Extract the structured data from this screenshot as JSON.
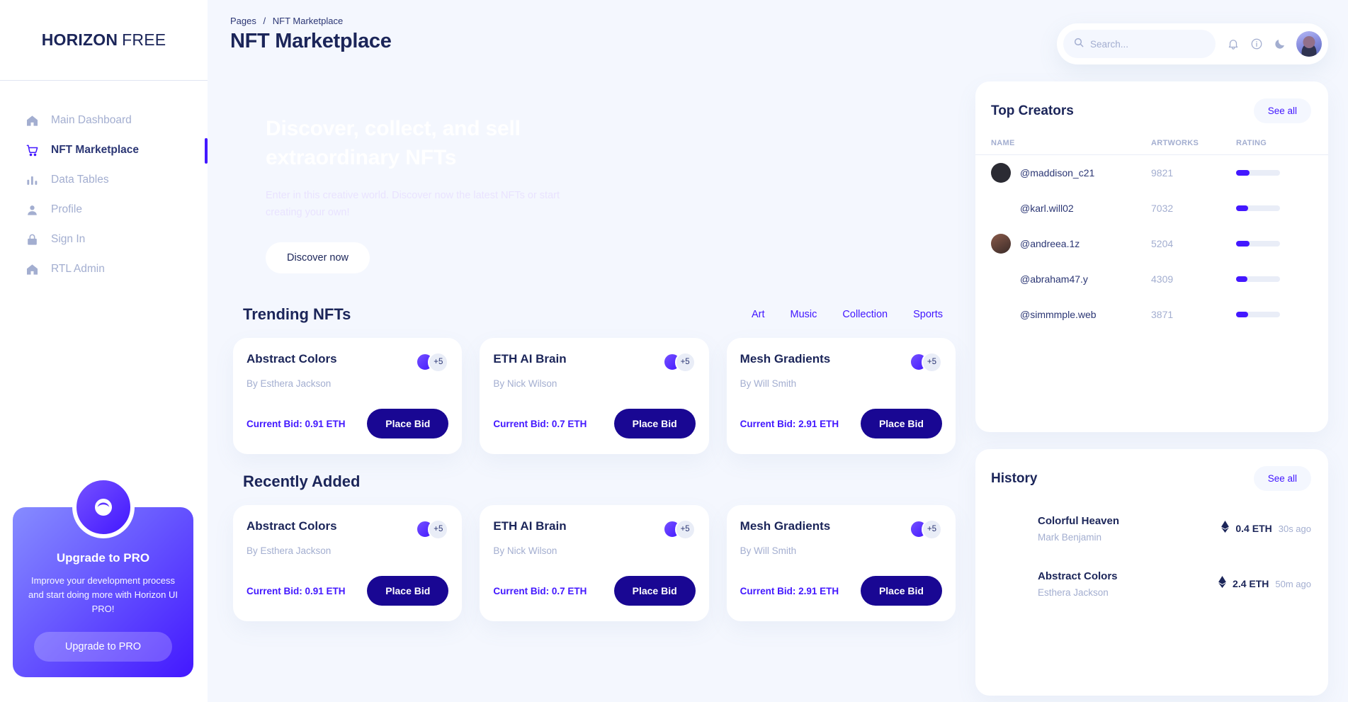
{
  "sidebar": {
    "brand_bold": "HORIZON",
    "brand_light": "FREE",
    "items": [
      {
        "label": "Main Dashboard",
        "icon": "home-icon",
        "active": false
      },
      {
        "label": "NFT Marketplace",
        "icon": "cart-icon",
        "active": true
      },
      {
        "label": "Data Tables",
        "icon": "bar-chart-icon",
        "active": false
      },
      {
        "label": "Profile",
        "icon": "person-icon",
        "active": false
      },
      {
        "label": "Sign In",
        "icon": "lock-icon",
        "active": false
      },
      {
        "label": "RTL Admin",
        "icon": "home-icon",
        "active": false
      }
    ],
    "upgrade": {
      "title": "Upgrade to PRO",
      "description": "Improve your development process and start doing more with Horizon UI PRO!",
      "button_label": "Upgrade to PRO"
    }
  },
  "header": {
    "breadcrumb_parent": "Pages",
    "breadcrumb_separator": "/",
    "breadcrumb_current": "NFT Marketplace",
    "title": "NFT Marketplace",
    "search_placeholder": "Search...",
    "search_value": "",
    "icons": [
      "search-icon",
      "bell-icon",
      "info-icon",
      "moon-icon",
      "avatar"
    ]
  },
  "banner": {
    "headline": "Discover, collect, and sell extraordinary NFTs",
    "subtext": "Enter in this creative world. Discover now the latest NFTs or start creating your own!",
    "button_label": "Discover now"
  },
  "trending": {
    "title": "Trending NFTs",
    "tabs": [
      "Art",
      "Music",
      "Collection",
      "Sports"
    ],
    "cards": [
      {
        "name": "Abstract Colors",
        "author": "By Esthera Jackson",
        "bid": "Current Bid: 0.91 ETH",
        "button_label": "Place Bid",
        "extra_avatars": "+5"
      },
      {
        "name": "ETH AI Brain",
        "author": "By Nick Wilson",
        "bid": "Current Bid: 0.7 ETH",
        "button_label": "Place Bid",
        "extra_avatars": "+5"
      },
      {
        "name": "Mesh Gradients",
        "author": "By Will Smith",
        "bid": "Current Bid: 2.91 ETH",
        "button_label": "Place Bid",
        "extra_avatars": "+5"
      }
    ]
  },
  "recently_added": {
    "title": "Recently Added",
    "cards": [
      {
        "name": "Abstract Colors",
        "author": "By Esthera Jackson",
        "bid": "Current Bid: 0.91 ETH",
        "button_label": "Place Bid",
        "extra_avatars": "+5"
      },
      {
        "name": "ETH AI Brain",
        "author": "By Nick Wilson",
        "bid": "Current Bid: 0.7 ETH",
        "button_label": "Place Bid",
        "extra_avatars": "+5"
      },
      {
        "name": "Mesh Gradients",
        "author": "By Will Smith",
        "bid": "Current Bid: 2.91 ETH",
        "button_label": "Place Bid",
        "extra_avatars": "+5"
      }
    ]
  },
  "top_creators": {
    "title": "Top Creators",
    "see_all_label": "See all",
    "columns": [
      "NAME",
      "ARTWORKS",
      "RATING"
    ],
    "rows": [
      {
        "name": "@maddison_c21",
        "artworks": "9821",
        "rating_pct": 30,
        "has_avatar": true
      },
      {
        "name": "@karl.will02",
        "artworks": "7032",
        "rating_pct": 27,
        "has_avatar": false
      },
      {
        "name": "@andreea.1z",
        "artworks": "5204",
        "rating_pct": 30,
        "has_avatar": true
      },
      {
        "name": "@abraham47.y",
        "artworks": "4309",
        "rating_pct": 25,
        "has_avatar": false
      },
      {
        "name": "@simmmple.web",
        "artworks": "3871",
        "rating_pct": 28,
        "has_avatar": false
      }
    ]
  },
  "history": {
    "title": "History",
    "see_all_label": "See all",
    "rows": [
      {
        "name": "Colorful Heaven",
        "author": "Mark Benjamin",
        "price": "0.4 ETH",
        "time": "30s ago"
      },
      {
        "name": "Abstract Colors",
        "author": "Esthera Jackson",
        "price": "2.4 ETH",
        "time": "50m ago"
      }
    ]
  },
  "colors": {
    "accent": "#4318FF",
    "bid_button": "#190793",
    "page_bg": "#F4F7FE",
    "text_dark": "#1B2559",
    "text_muted": "#A3AED0"
  }
}
